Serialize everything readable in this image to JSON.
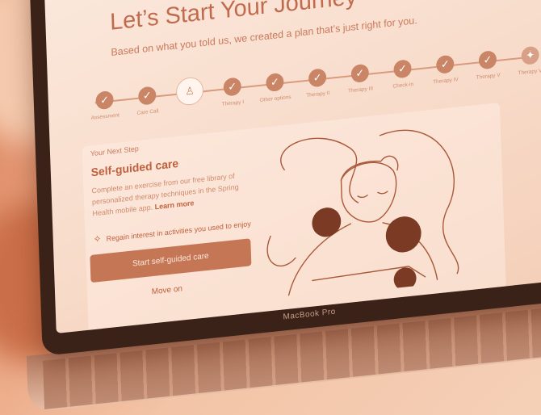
{
  "screen": {
    "title": "Let’s Start Your Journey",
    "subtitle": "Based on what you told us, we created a plan that’s just right for you.",
    "steps": [
      {
        "label": "Assessment",
        "status": "done"
      },
      {
        "label": "Care Call",
        "status": "done"
      },
      {
        "label": "",
        "status": "current"
      },
      {
        "label": "Therapy I",
        "status": "done"
      },
      {
        "label": "Other options",
        "status": "done"
      },
      {
        "label": "Therapy II",
        "status": "done"
      },
      {
        "label": "Therapy III",
        "status": "done"
      },
      {
        "label": "Check-in",
        "status": "done"
      },
      {
        "label": "Therapy IV",
        "status": "done"
      },
      {
        "label": "Therapy V",
        "status": "done"
      },
      {
        "label": "Therapy VI",
        "status": "pending"
      }
    ],
    "next_step_label": "Your Next Step",
    "care_title": "Self-guided care",
    "description": "Complete an exercise from our free library of personalized therapy techniques in the Spring Health mobile app.",
    "learn_more": "Learn more",
    "interest_text": "Regain interest in activities you used to enjoy",
    "start_button": "Start self-guided care",
    "move_on": "Move on"
  },
  "laptop_brand": "MacBook Pro",
  "icons": {
    "step_done": "check-icon",
    "step_current": "person-icon",
    "step_pending": "figure-icon",
    "interest": "sparkle-icon"
  },
  "colors": {
    "accent": "#c0603c",
    "tint": "#e9a07c"
  }
}
